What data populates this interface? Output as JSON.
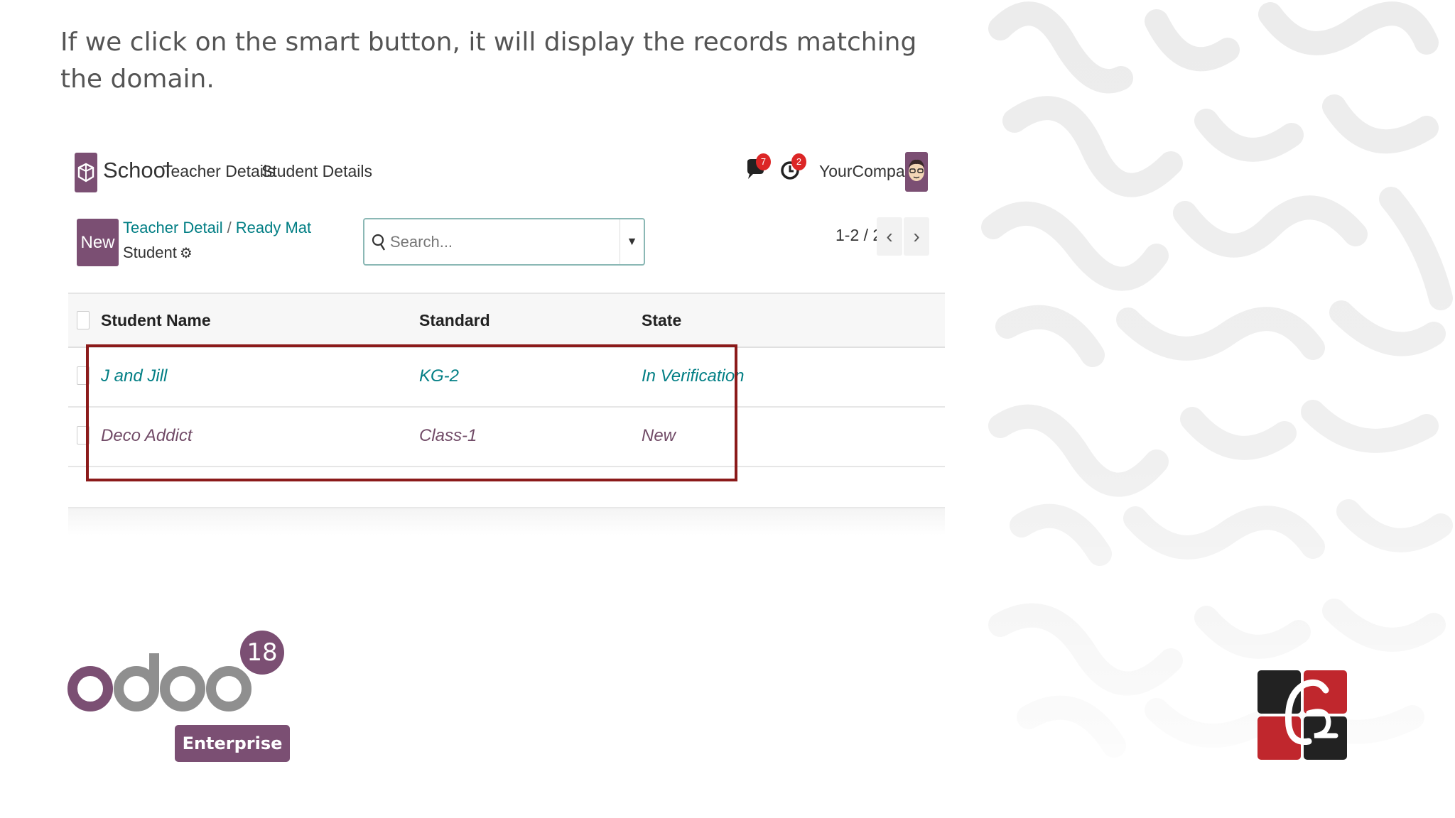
{
  "caption": "If we click on the smart button, it will display the records matching the domain.",
  "app": {
    "name": "School",
    "menu": [
      "Teacher Details",
      "Student Details"
    ],
    "systray": {
      "messages_count": "7",
      "activities_count": "2",
      "company": "YourCompany"
    }
  },
  "control_panel": {
    "new_label": "New",
    "breadcrumb": [
      "Teacher Detail",
      "Ready Mat"
    ],
    "current": "Student",
    "search_placeholder": "Search...",
    "pager": "1-2 / 2"
  },
  "list": {
    "columns": [
      "Student Name",
      "Standard",
      "State"
    ],
    "rows": [
      {
        "name": "J and Jill",
        "standard": "KG-2",
        "state": "In Verification",
        "color": "#017e84"
      },
      {
        "name": "Deco Addict",
        "standard": "Class-1",
        "state": "New",
        "color": "#714b67"
      }
    ]
  },
  "branding": {
    "product": "odoo",
    "version": "18",
    "edition": "Enterprise"
  },
  "colors": {
    "odoo_purple": "#7b4f73",
    "highlight": "#8b1a1a",
    "teal": "#017e84"
  }
}
